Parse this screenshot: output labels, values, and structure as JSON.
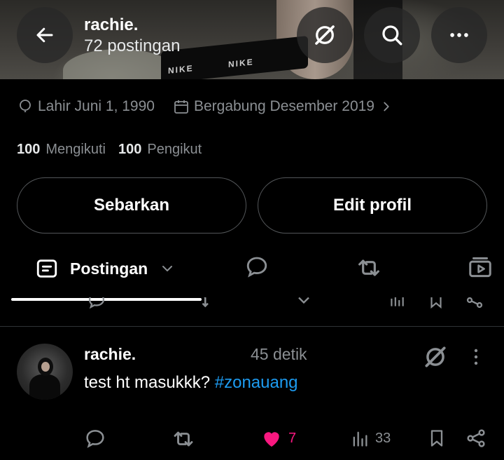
{
  "header": {
    "name": "rachie.",
    "post_count": "72 postingan",
    "banner_text_left": "NIKE",
    "banner_text_right": "NIKE"
  },
  "profile": {
    "birth": "Lahir Juni 1, 1990",
    "joined": "Bergabung Desember 2019",
    "following_count": "100",
    "following_label": "Mengikuti",
    "followers_count": "100",
    "followers_label": "Pengikut"
  },
  "buttons": {
    "share": "Sebarkan",
    "edit": "Edit profil"
  },
  "tabs": {
    "active_label": "Postingan"
  },
  "post": {
    "author": "rachie.",
    "time": "45 detik",
    "text": "test ht masukkk? ",
    "hashtag": "#zonauang",
    "likes": "7",
    "views": "33"
  },
  "colors": {
    "background": "#000000",
    "muted": "#8b8f93",
    "hashtag": "#1d9bf0",
    "like": "#f91880",
    "border": "#535659"
  }
}
